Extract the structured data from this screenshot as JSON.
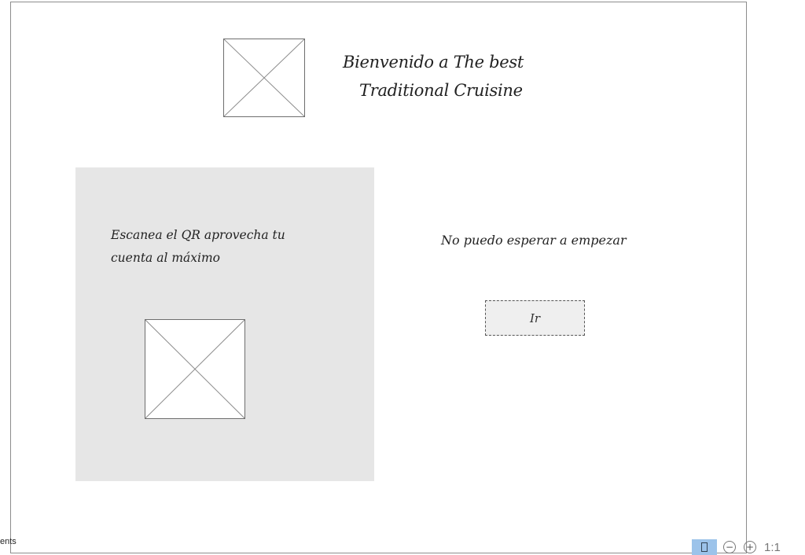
{
  "header": {
    "welcome_line1": "Bienvenido a The best",
    "welcome_line2": "Traditional Cruisine"
  },
  "qr_panel": {
    "text_line1": "Escanea el QR  aprovecha tu",
    "text_line2": "cuenta al máximo"
  },
  "cta": {
    "text": "No puedo esperar a empezar",
    "button_label": "Ir"
  },
  "footer": {
    "label": "ents"
  },
  "toolbar": {
    "zoom_out_symbol": "−",
    "zoom_in_symbol": "+",
    "reset_zoom_label": "1:1"
  },
  "colors": {
    "panel_background": "#e6e6e6",
    "border": "#8c8c8c",
    "toolbar_active": "#9cc3ea"
  }
}
